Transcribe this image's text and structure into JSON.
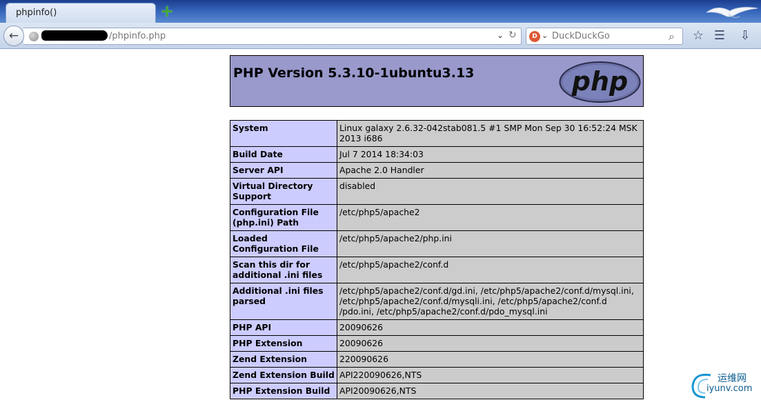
{
  "browser": {
    "tab_title": "phpinfo()",
    "url": "/phpinfo.php",
    "search_placeholder": "DuckDuckGo"
  },
  "phpinfo": {
    "version_title": "PHP Version 5.3.10-1ubuntu3.13",
    "logo_text": "php",
    "rows": [
      {
        "label": "System",
        "value": "Linux galaxy 2.6.32-042stab081.5 #1 SMP Mon Sep 30 16:52:24 MSK 2013 i686"
      },
      {
        "label": "Build Date",
        "value": "Jul 7 2014 18:34:03"
      },
      {
        "label": "Server API",
        "value": "Apache 2.0 Handler"
      },
      {
        "label": "Virtual Directory Support",
        "value": "disabled"
      },
      {
        "label": "Configuration File (php.ini) Path",
        "value": "/etc/php5/apache2"
      },
      {
        "label": "Loaded Configuration File",
        "value": "/etc/php5/apache2/php.ini"
      },
      {
        "label": "Scan this dir for additional .ini files",
        "value": "/etc/php5/apache2/conf.d"
      },
      {
        "label": "Additional .ini files parsed",
        "value": "/etc/php5/apache2/conf.d/gd.ini, /etc/php5/apache2/conf.d/mysql.ini, /etc/php5/apache2/conf.d/mysqli.ini, /etc/php5/apache2/conf.d /pdo.ini, /etc/php5/apache2/conf.d/pdo_mysql.ini"
      },
      {
        "label": "PHP API",
        "value": "20090626"
      },
      {
        "label": "PHP Extension",
        "value": "20090626"
      },
      {
        "label": "Zend Extension",
        "value": "220090626"
      },
      {
        "label": "Zend Extension Build",
        "value": "API220090626,NTS"
      },
      {
        "label": "PHP Extension Build",
        "value": "API20090626,NTS"
      }
    ]
  },
  "watermark": {
    "cn": "运维网",
    "en": "iyunv.com"
  },
  "colors": {
    "header_bg": "#9999cc",
    "label_bg": "#ccccff",
    "value_bg": "#cccccc"
  }
}
